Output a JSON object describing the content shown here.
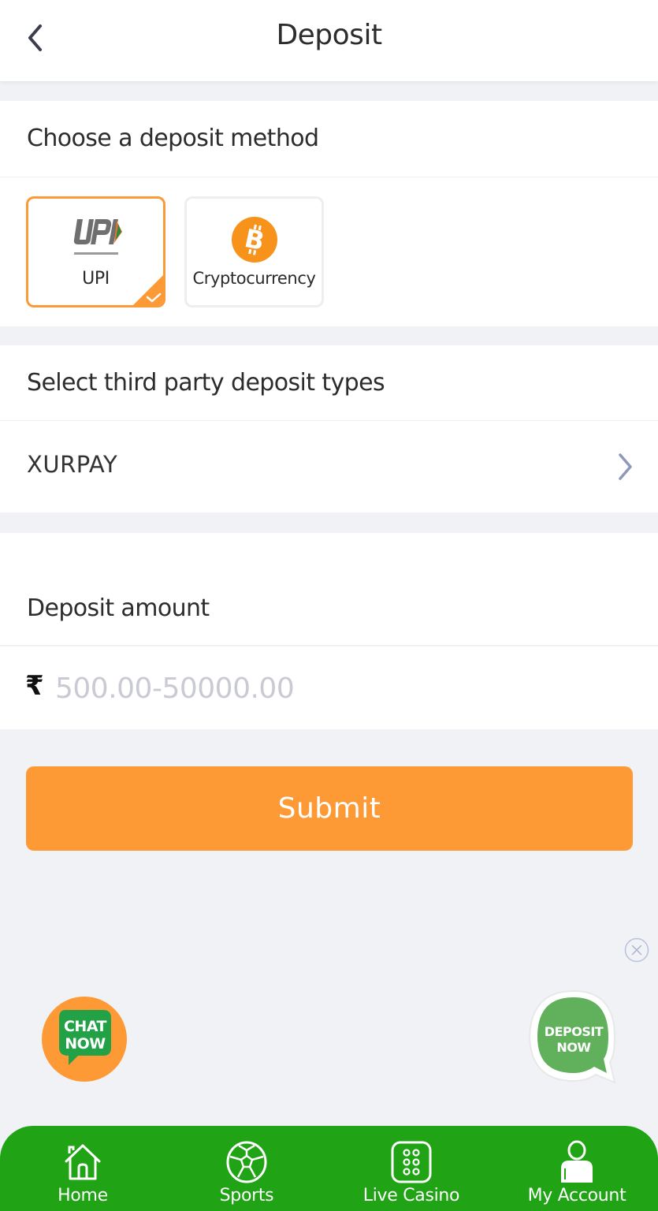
{
  "header": {
    "title": "Deposit",
    "back_icon": "chevron-left-icon"
  },
  "deposit_method": {
    "title": "Choose a deposit method",
    "methods": [
      {
        "label": "UPI",
        "icon": "upi-logo-icon",
        "selected": true
      },
      {
        "label": "Cryptocurrency",
        "icon": "bitcoin-icon",
        "selected": false
      }
    ]
  },
  "third_party": {
    "title": "Select third party deposit types",
    "selected_type": "XURPAY",
    "chevron_icon": "chevron-right-icon"
  },
  "amount": {
    "title": "Deposit amount",
    "currency_symbol": "₹",
    "value": "",
    "placeholder": "500.00-50000.00"
  },
  "submit_label": "Submit",
  "floating": {
    "chat": {
      "line1": "CHAT",
      "line2": "NOW"
    },
    "deposit": {
      "line1": "DEPOSIT",
      "line2": "NOW"
    }
  },
  "bottom_nav": {
    "items": [
      {
        "label": "Home",
        "icon": "home-icon"
      },
      {
        "label": "Sports",
        "icon": "soccer-ball-icon"
      },
      {
        "label": "Live Casino",
        "icon": "dice-icon"
      },
      {
        "label": "My Account",
        "icon": "user-icon"
      }
    ]
  },
  "colors": {
    "accent": "#fd9a36",
    "nav_green": "#20a314",
    "page_bg": "#f1f2f6",
    "placeholder": "#c9cad3"
  }
}
